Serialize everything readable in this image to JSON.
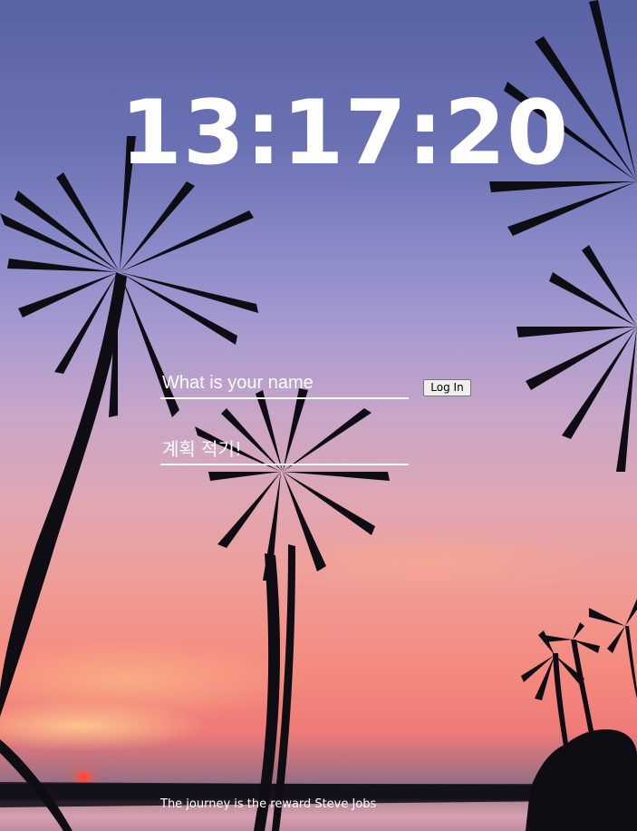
{
  "clock": {
    "time": "13:17:20"
  },
  "login": {
    "name_placeholder": "What is your name",
    "login_button": "Log In"
  },
  "todo": {
    "placeholder": "계획 적기!"
  },
  "quote": {
    "text": "The journey is the reward",
    "author": "Steve Jobs"
  },
  "background": {
    "sky_top": "#5a62a6",
    "sky_bottom": "#f07a78",
    "sun_color": "#ff4a40"
  }
}
